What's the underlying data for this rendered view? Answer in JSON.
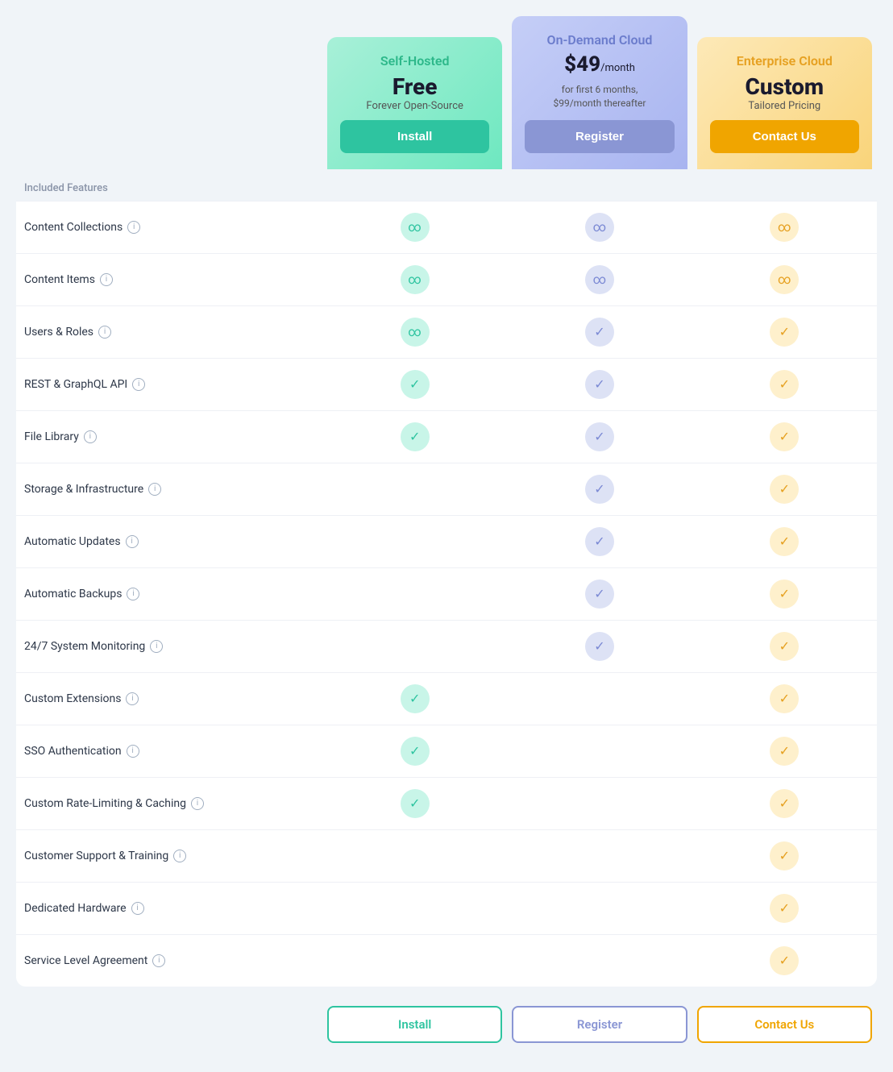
{
  "plans": [
    {
      "id": "self-hosted",
      "name": "Self-Hosted",
      "price": "Free",
      "price_sub": "Forever Open-Source",
      "button_label": "Install",
      "button_class": "btn-install",
      "card_class": "self-hosted",
      "name_class": "self-hosted"
    },
    {
      "id": "on-demand",
      "name": "On-Demand Cloud",
      "price": "$49",
      "price_period": "/month",
      "price_sub": "for first 6 months,\n$99/month thereafter",
      "button_label": "Register",
      "button_class": "btn-register",
      "card_class": "on-demand",
      "name_class": "on-demand"
    },
    {
      "id": "enterprise",
      "name": "Enterprise Cloud",
      "price": "Custom",
      "price_sub": "Tailored Pricing",
      "button_label": "Contact Us",
      "button_class": "btn-contact",
      "card_class": "enterprise",
      "name_class": "enterprise"
    }
  ],
  "section_label": "Included Features",
  "features": [
    {
      "name": "Content Collections",
      "has_info": true,
      "self_hosted": "infinity",
      "on_demand": "infinity",
      "enterprise": "infinity"
    },
    {
      "name": "Content Items",
      "has_info": true,
      "self_hosted": "infinity",
      "on_demand": "infinity",
      "enterprise": "infinity"
    },
    {
      "name": "Users & Roles",
      "has_info": true,
      "self_hosted": "infinity",
      "on_demand": "check",
      "enterprise": "check"
    },
    {
      "name": "REST & GraphQL API",
      "has_info": true,
      "self_hosted": "check",
      "on_demand": "check",
      "enterprise": "check"
    },
    {
      "name": "File Library",
      "has_info": true,
      "self_hosted": "check",
      "on_demand": "check",
      "enterprise": "check"
    },
    {
      "name": "Storage & Infrastructure",
      "has_info": true,
      "self_hosted": "none",
      "on_demand": "check",
      "enterprise": "check"
    },
    {
      "name": "Automatic Updates",
      "has_info": true,
      "self_hosted": "none",
      "on_demand": "check",
      "enterprise": "check"
    },
    {
      "name": "Automatic Backups",
      "has_info": true,
      "self_hosted": "none",
      "on_demand": "check",
      "enterprise": "check"
    },
    {
      "name": "24/7 System Monitoring",
      "has_info": true,
      "self_hosted": "none",
      "on_demand": "check",
      "enterprise": "check"
    },
    {
      "name": "Custom Extensions",
      "has_info": true,
      "self_hosted": "check",
      "on_demand": "none",
      "enterprise": "check"
    },
    {
      "name": "SSO Authentication",
      "has_info": true,
      "self_hosted": "check",
      "on_demand": "none",
      "enterprise": "check"
    },
    {
      "name": "Custom Rate-Limiting & Caching",
      "has_info": true,
      "self_hosted": "check",
      "on_demand": "none",
      "enterprise": "check"
    },
    {
      "name": "Customer Support & Training",
      "has_info": true,
      "self_hosted": "none",
      "on_demand": "none",
      "enterprise": "check"
    },
    {
      "name": "Dedicated Hardware",
      "has_info": true,
      "self_hosted": "none",
      "on_demand": "none",
      "enterprise": "check"
    },
    {
      "name": "Service Level Agreement",
      "has_info": true,
      "self_hosted": "none",
      "on_demand": "none",
      "enterprise": "check"
    }
  ],
  "bottom_buttons": [
    {
      "label": "Install",
      "class": "bottom-btn-install"
    },
    {
      "label": "Register",
      "class": "bottom-btn-register"
    },
    {
      "label": "Contact Us",
      "class": "bottom-btn-contact"
    }
  ]
}
